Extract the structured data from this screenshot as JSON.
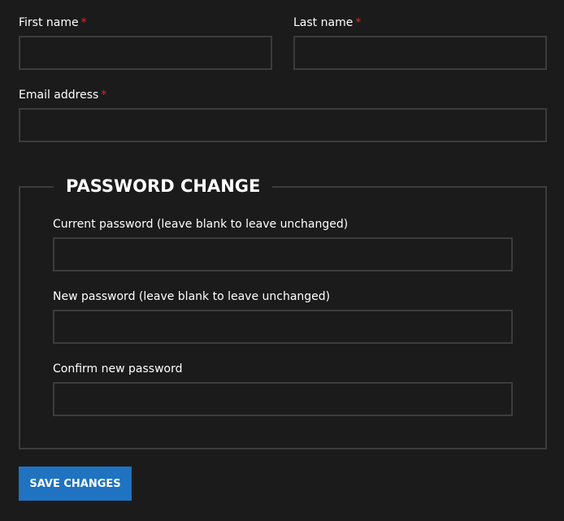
{
  "form": {
    "first_name": {
      "label": "First name",
      "required_mark": "*",
      "value": ""
    },
    "last_name": {
      "label": "Last name",
      "required_mark": "*",
      "value": ""
    },
    "email": {
      "label": "Email address",
      "required_mark": "*",
      "value": ""
    }
  },
  "password_change": {
    "legend": "PASSWORD CHANGE",
    "current_label": "Current password (leave blank to leave unchanged)",
    "new_label": "New password (leave blank to leave unchanged)",
    "confirm_label": "Confirm new password"
  },
  "actions": {
    "save_label": "SAVE CHANGES"
  },
  "colors": {
    "background": "#1b1b1b",
    "input_border": "#3c3c3c",
    "required": "#e2251e",
    "button": "#1f73c1",
    "text": "#ffffff"
  }
}
